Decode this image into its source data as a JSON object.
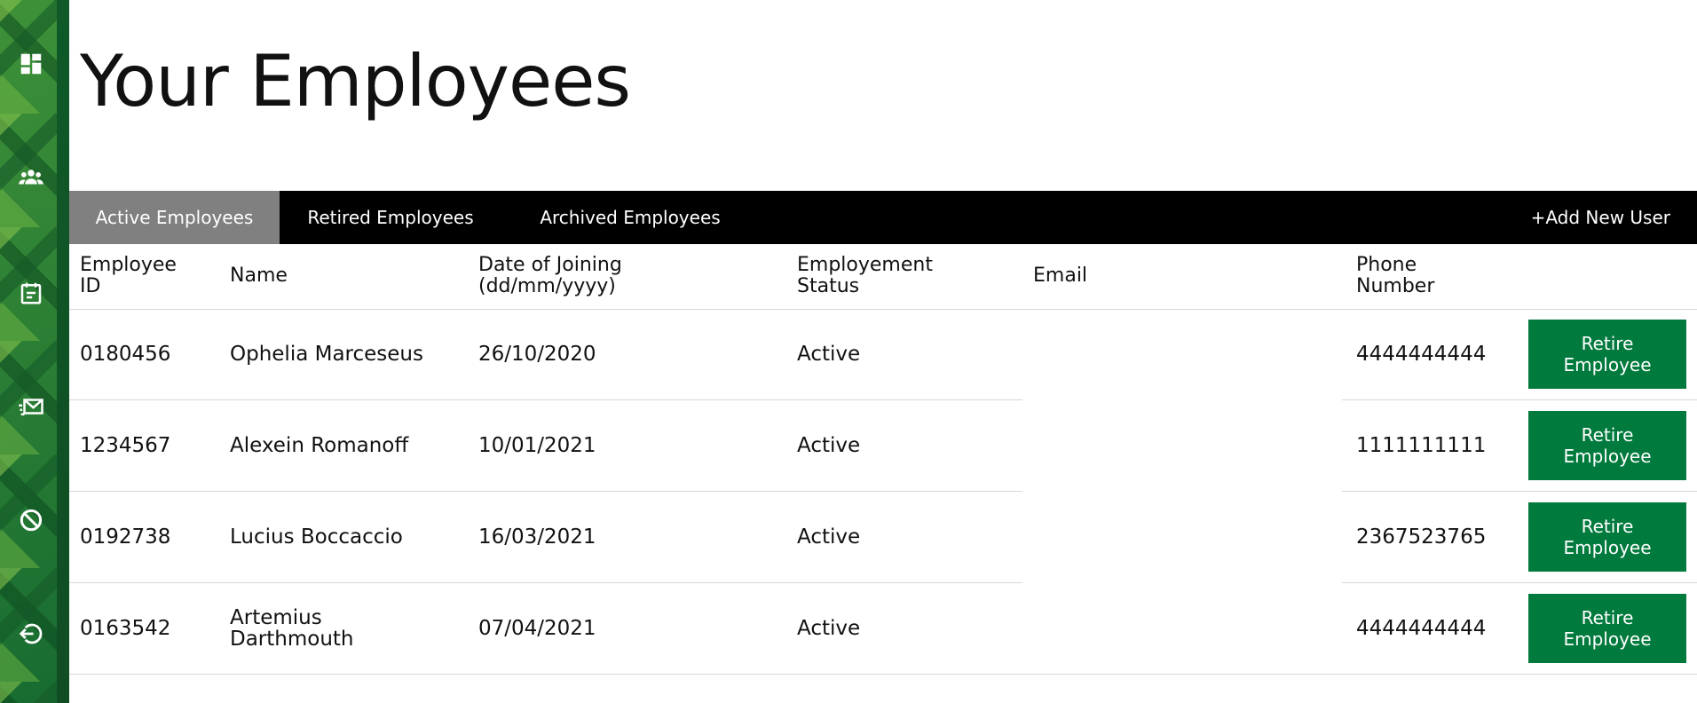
{
  "sidebar": {
    "items": [
      {
        "icon": "dashboard-icon"
      },
      {
        "icon": "users-icon"
      },
      {
        "icon": "calendar-icon"
      },
      {
        "icon": "mail-icon"
      },
      {
        "icon": "block-icon"
      },
      {
        "icon": "logout-icon"
      }
    ]
  },
  "page": {
    "title": "Your Employees"
  },
  "tabs": {
    "active": "Active Employees",
    "retired": "Retired Employees",
    "archived": "Archived Employees",
    "add_user": "+Add New User"
  },
  "table": {
    "headers": {
      "employee_id_1": "Employee",
      "employee_id_2": "ID",
      "name": "Name",
      "date_1": "Date of Joining",
      "date_2": "(dd/mm/yyyy)",
      "status_1": "Employement",
      "status_2": "Status",
      "email": "Email",
      "phone_1": "Phone",
      "phone_2": "Number"
    },
    "rows": [
      {
        "id": "0180456",
        "name_1": "Ophelia Marceseus",
        "name_2": "",
        "date": "26/10/2020",
        "status": "Active",
        "email": "",
        "phone": "4444444444",
        "action_1": "Retire",
        "action_2": "Employee"
      },
      {
        "id": "1234567",
        "name_1": "Alexein Romanoff",
        "name_2": "",
        "date": "10/01/2021",
        "status": "Active",
        "email": "",
        "phone": "1111111111",
        "action_1": "Retire",
        "action_2": "Employee"
      },
      {
        "id": "0192738",
        "name_1": "Lucius Boccaccio",
        "name_2": "",
        "date": "16/03/2021",
        "status": "Active",
        "email": "",
        "phone": "2367523765",
        "action_1": "Retire",
        "action_2": "Employee"
      },
      {
        "id": "0163542",
        "name_1": "Artemius",
        "name_2": "Darthmouth",
        "date": "07/04/2021",
        "status": "Active",
        "email": "",
        "phone": "4444444444",
        "action_1": "Retire",
        "action_2": "Employee"
      }
    ]
  },
  "colors": {
    "sidebar": "#1e7a35",
    "tabbar": "#000000",
    "active_tab": "#808080",
    "button": "#007a3d"
  }
}
